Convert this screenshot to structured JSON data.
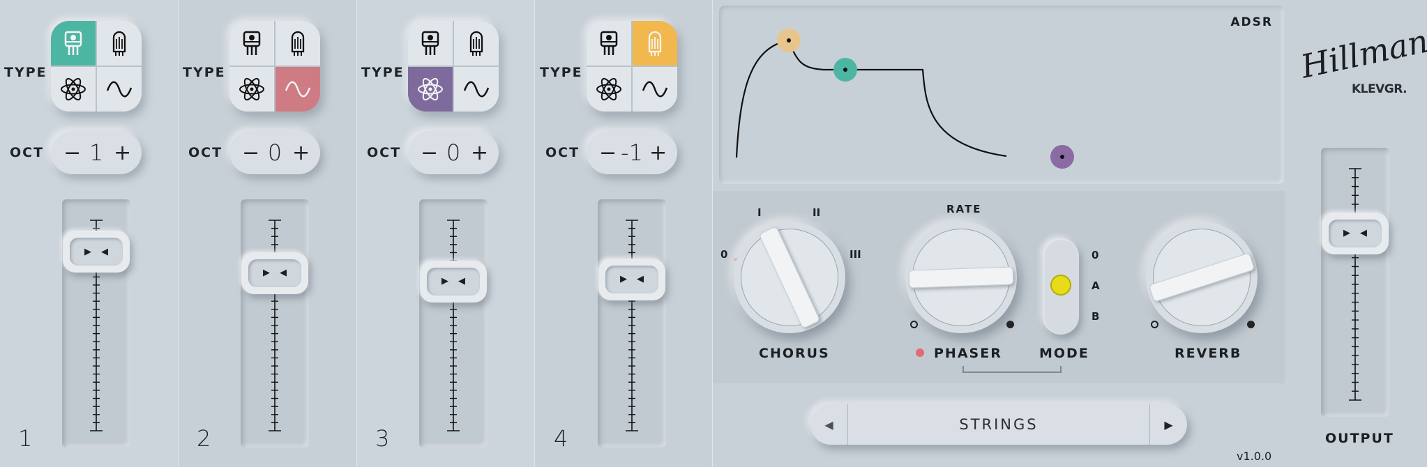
{
  "oscillators": [
    {
      "number": "1",
      "type_label": "TYPE",
      "oct_label": "OCT",
      "minus": "−",
      "plus": "+",
      "octave": "1",
      "selected": "transistor",
      "selected_color": "#4db6a3",
      "level": 0.85
    },
    {
      "number": "2",
      "type_label": "TYPE",
      "oct_label": "OCT",
      "minus": "−",
      "plus": "+",
      "octave": "0",
      "selected": "sine",
      "selected_color": "#cf7b83",
      "level": 0.75
    },
    {
      "number": "3",
      "type_label": "TYPE",
      "oct_label": "OCT",
      "minus": "−",
      "plus": "+",
      "octave": "0",
      "selected": "atom",
      "selected_color": "#7f6a9d",
      "level": 0.71
    },
    {
      "number": "4",
      "type_label": "TYPE",
      "oct_label": "OCT",
      "minus": "−",
      "plus": "+",
      "octave": "-1",
      "selected": "tube",
      "selected_color": "#f2b84e",
      "level": 0.72
    }
  ],
  "type_icons": [
    "transistor-icon",
    "tube-icon",
    "atom-icon",
    "sine-icon"
  ],
  "envelope": {
    "title": "ADSR",
    "attack_color": "#e8c58d",
    "decay_color": "#4db6a3",
    "release_color": "#8a6ba3"
  },
  "chorus": {
    "label": "CHORUS",
    "positions": [
      "0",
      "I",
      "II",
      "III"
    ],
    "value": "I"
  },
  "phaser": {
    "label": "PHASER",
    "rate_label": "RATE",
    "indicator_color": "#e26a74",
    "value": 0.5
  },
  "mode": {
    "label": "MODE",
    "options": [
      "0",
      "A",
      "B"
    ],
    "value": "A",
    "indicator_color": "#e6dc1a"
  },
  "reverb": {
    "label": "REVERB",
    "value": 0.85
  },
  "preset": {
    "name": "STRINGS",
    "prev_icon": "chevron-left-icon",
    "next_icon": "chevron-right-icon"
  },
  "output": {
    "label": "OUTPUT",
    "level": 0.72
  },
  "brand": {
    "name": "Hillman",
    "maker": "KLEVGR."
  },
  "version": "v1.0.0"
}
